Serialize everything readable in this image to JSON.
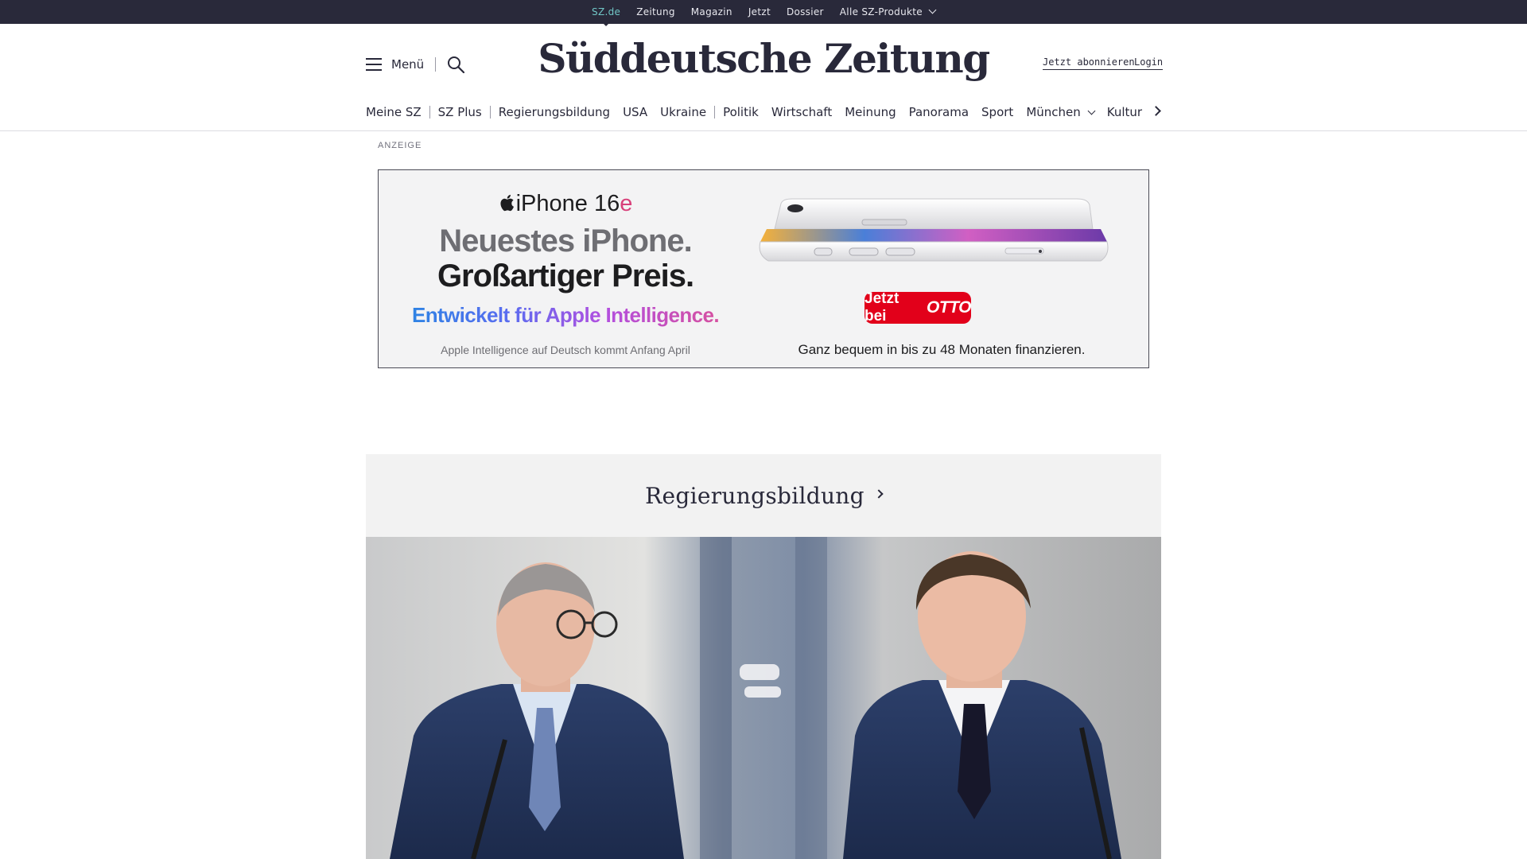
{
  "topbar": {
    "links": [
      "SZ.de",
      "Zeitung",
      "Magazin",
      "Jetzt",
      "Dossier",
      "Alle SZ-Produkte"
    ]
  },
  "header": {
    "menu_label": "Menü",
    "logo_text": "Süddeutsche Zeitung",
    "subscribe_label": "Jetzt abonnieren",
    "login_label": "Login"
  },
  "category_nav": {
    "items": [
      "Meine SZ",
      "SZ Plus",
      "Regierungsbildung",
      "USA",
      "Ukraine",
      "Politik",
      "Wirtschaft",
      "Meinung",
      "Panorama",
      "Sport",
      "München",
      "Kultur"
    ]
  },
  "ad": {
    "label": "ANZEIGE",
    "brand_main": "iPhone 16",
    "brand_suffix": "e",
    "headline_1": "Neuestes iPhone.",
    "headline_2": "Großartiger Preis.",
    "intelligence": "Entwickelt für Apple Intelligence.",
    "note": "Apple Intelligence auf Deutsch kommt Anfang April",
    "cta_prefix": "Jetzt bei",
    "cta_brand": "OTTO",
    "finance": "Ganz bequem in bis zu 48 Monaten finanzieren.",
    "colors": {
      "cta": "#e2001a",
      "gradient_start": "#1f8ae0",
      "gradient_end": "#e0508e"
    }
  },
  "teaser": {
    "section_title": "Regierungsbildung"
  },
  "colors": {
    "topbar_bg": "#29293a",
    "active_link": "#71c7c7",
    "text": "#29293a",
    "teaser_bg": "#f2f2f2"
  }
}
